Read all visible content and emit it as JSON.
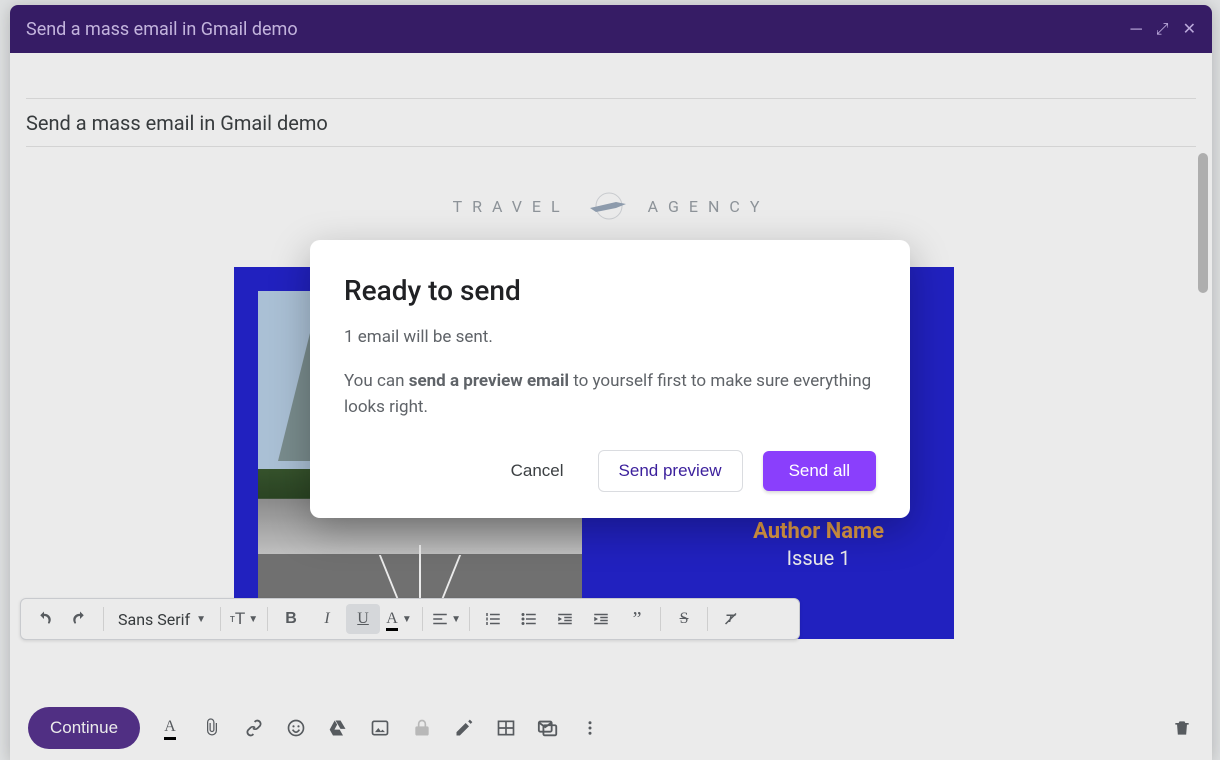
{
  "titlebar": {
    "title": "Send a mass email in Gmail demo"
  },
  "subject": "Send a mass email in Gmail demo",
  "brand": {
    "left": "TRAVEL",
    "right": "AGENCY"
  },
  "newsletter": {
    "author": "Author Name",
    "issue": "Issue 1"
  },
  "format": {
    "font": "Sans Serif"
  },
  "bottom": {
    "continue": "Continue"
  },
  "modal": {
    "title": "Ready to send",
    "line1": "1 email will be sent.",
    "line2_pre": "You can ",
    "line2_bold": "send a preview email",
    "line2_post": " to yourself first to make sure everything looks right.",
    "cancel": "Cancel",
    "preview": "Send preview",
    "sendall": "Send all"
  }
}
